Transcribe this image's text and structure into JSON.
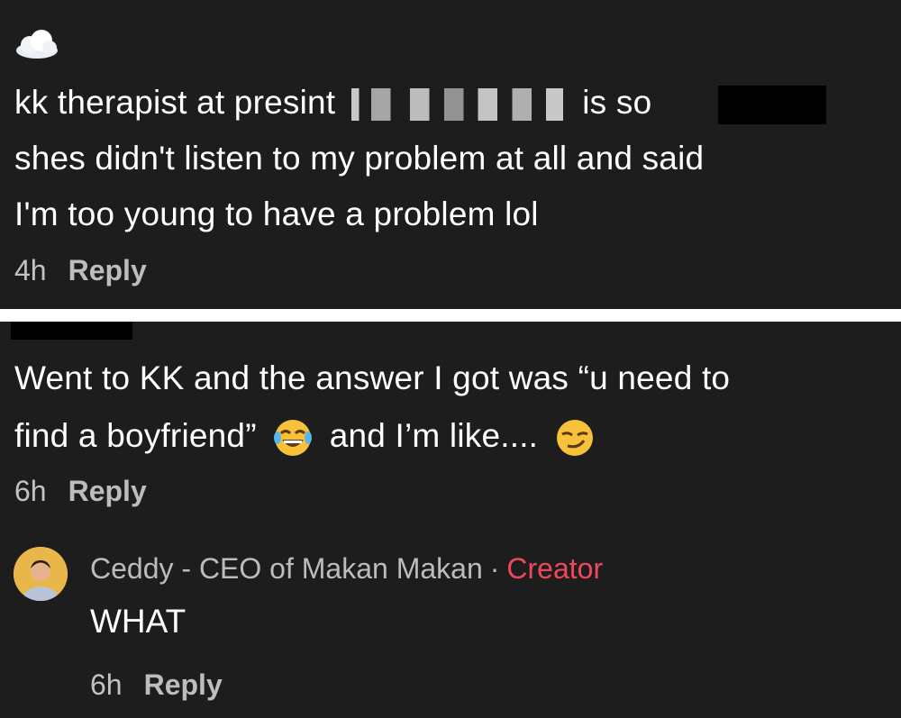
{
  "comment1": {
    "icon": "cloud-icon",
    "line1_start": "kk therapist at presint",
    "line1_end": "is so",
    "line2": "shes didn't listen to my problem at all and said",
    "line3": "I'm too young to have a problem lol",
    "time": "4h",
    "reply_label": "Reply"
  },
  "comment2": {
    "line1": "Went to KK and the answer I got was “u need to",
    "line2_start": "find a boyfriend”",
    "line2_mid": "and I’m like....",
    "emojis": [
      "tears-of-joy-emoji",
      "smirk-emoji"
    ],
    "time": "6h",
    "reply_label": "Reply"
  },
  "reply": {
    "username": "Ceddy - CEO of Makan Makan",
    "separator": "·",
    "badge": "Creator",
    "text": "WHAT",
    "time": "6h",
    "reply_label": "Reply"
  },
  "colors": {
    "background": "#1d1d1d",
    "creator": "#f0475c",
    "meta": "#bdbdbd"
  }
}
